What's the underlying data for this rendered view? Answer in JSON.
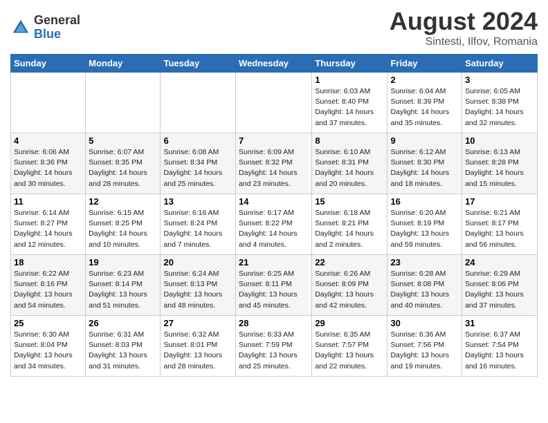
{
  "header": {
    "logo_general": "General",
    "logo_blue": "Blue",
    "month_year": "August 2024",
    "location": "Sintesti, Ilfov, Romania"
  },
  "days_of_week": [
    "Sunday",
    "Monday",
    "Tuesday",
    "Wednesday",
    "Thursday",
    "Friday",
    "Saturday"
  ],
  "weeks": [
    [
      {
        "day": "",
        "info": ""
      },
      {
        "day": "",
        "info": ""
      },
      {
        "day": "",
        "info": ""
      },
      {
        "day": "",
        "info": ""
      },
      {
        "day": "1",
        "info": "Sunrise: 6:03 AM\nSunset: 8:40 PM\nDaylight: 14 hours\nand 37 minutes."
      },
      {
        "day": "2",
        "info": "Sunrise: 6:04 AM\nSunset: 8:39 PM\nDaylight: 14 hours\nand 35 minutes."
      },
      {
        "day": "3",
        "info": "Sunrise: 6:05 AM\nSunset: 8:38 PM\nDaylight: 14 hours\nand 32 minutes."
      }
    ],
    [
      {
        "day": "4",
        "info": "Sunrise: 6:06 AM\nSunset: 8:36 PM\nDaylight: 14 hours\nand 30 minutes."
      },
      {
        "day": "5",
        "info": "Sunrise: 6:07 AM\nSunset: 8:35 PM\nDaylight: 14 hours\nand 28 minutes."
      },
      {
        "day": "6",
        "info": "Sunrise: 6:08 AM\nSunset: 8:34 PM\nDaylight: 14 hours\nand 25 minutes."
      },
      {
        "day": "7",
        "info": "Sunrise: 6:09 AM\nSunset: 8:32 PM\nDaylight: 14 hours\nand 23 minutes."
      },
      {
        "day": "8",
        "info": "Sunrise: 6:10 AM\nSunset: 8:31 PM\nDaylight: 14 hours\nand 20 minutes."
      },
      {
        "day": "9",
        "info": "Sunrise: 6:12 AM\nSunset: 8:30 PM\nDaylight: 14 hours\nand 18 minutes."
      },
      {
        "day": "10",
        "info": "Sunrise: 6:13 AM\nSunset: 8:28 PM\nDaylight: 14 hours\nand 15 minutes."
      }
    ],
    [
      {
        "day": "11",
        "info": "Sunrise: 6:14 AM\nSunset: 8:27 PM\nDaylight: 14 hours\nand 12 minutes."
      },
      {
        "day": "12",
        "info": "Sunrise: 6:15 AM\nSunset: 8:25 PM\nDaylight: 14 hours\nand 10 minutes."
      },
      {
        "day": "13",
        "info": "Sunrise: 6:16 AM\nSunset: 8:24 PM\nDaylight: 14 hours\nand 7 minutes."
      },
      {
        "day": "14",
        "info": "Sunrise: 6:17 AM\nSunset: 8:22 PM\nDaylight: 14 hours\nand 4 minutes."
      },
      {
        "day": "15",
        "info": "Sunrise: 6:18 AM\nSunset: 8:21 PM\nDaylight: 14 hours\nand 2 minutes."
      },
      {
        "day": "16",
        "info": "Sunrise: 6:20 AM\nSunset: 8:19 PM\nDaylight: 13 hours\nand 59 minutes."
      },
      {
        "day": "17",
        "info": "Sunrise: 6:21 AM\nSunset: 8:17 PM\nDaylight: 13 hours\nand 56 minutes."
      }
    ],
    [
      {
        "day": "18",
        "info": "Sunrise: 6:22 AM\nSunset: 8:16 PM\nDaylight: 13 hours\nand 54 minutes."
      },
      {
        "day": "19",
        "info": "Sunrise: 6:23 AM\nSunset: 8:14 PM\nDaylight: 13 hours\nand 51 minutes."
      },
      {
        "day": "20",
        "info": "Sunrise: 6:24 AM\nSunset: 8:13 PM\nDaylight: 13 hours\nand 48 minutes."
      },
      {
        "day": "21",
        "info": "Sunrise: 6:25 AM\nSunset: 8:11 PM\nDaylight: 13 hours\nand 45 minutes."
      },
      {
        "day": "22",
        "info": "Sunrise: 6:26 AM\nSunset: 8:09 PM\nDaylight: 13 hours\nand 42 minutes."
      },
      {
        "day": "23",
        "info": "Sunrise: 6:28 AM\nSunset: 8:08 PM\nDaylight: 13 hours\nand 40 minutes."
      },
      {
        "day": "24",
        "info": "Sunrise: 6:29 AM\nSunset: 8:06 PM\nDaylight: 13 hours\nand 37 minutes."
      }
    ],
    [
      {
        "day": "25",
        "info": "Sunrise: 6:30 AM\nSunset: 8:04 PM\nDaylight: 13 hours\nand 34 minutes."
      },
      {
        "day": "26",
        "info": "Sunrise: 6:31 AM\nSunset: 8:03 PM\nDaylight: 13 hours\nand 31 minutes."
      },
      {
        "day": "27",
        "info": "Sunrise: 6:32 AM\nSunset: 8:01 PM\nDaylight: 13 hours\nand 28 minutes."
      },
      {
        "day": "28",
        "info": "Sunrise: 6:33 AM\nSunset: 7:59 PM\nDaylight: 13 hours\nand 25 minutes."
      },
      {
        "day": "29",
        "info": "Sunrise: 6:35 AM\nSunset: 7:57 PM\nDaylight: 13 hours\nand 22 minutes."
      },
      {
        "day": "30",
        "info": "Sunrise: 6:36 AM\nSunset: 7:56 PM\nDaylight: 13 hours\nand 19 minutes."
      },
      {
        "day": "31",
        "info": "Sunrise: 6:37 AM\nSunset: 7:54 PM\nDaylight: 13 hours\nand 16 minutes."
      }
    ]
  ]
}
